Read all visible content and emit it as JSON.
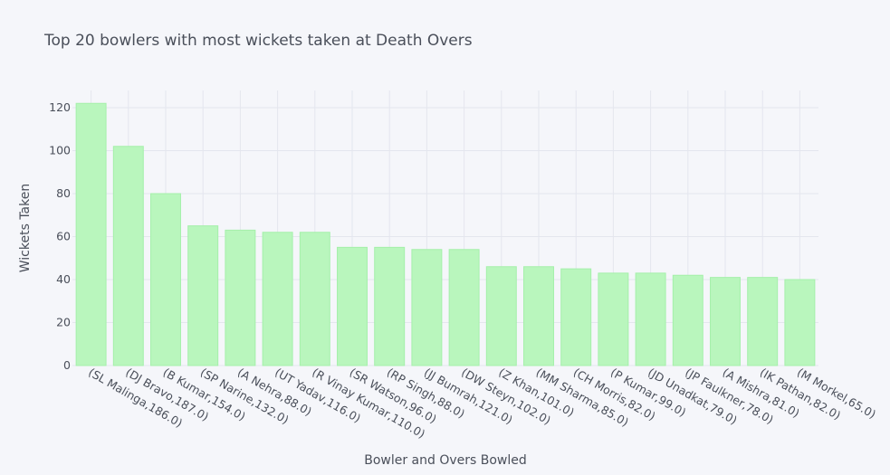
{
  "chart_data": {
    "type": "bar",
    "title": "Top 20 bowlers with most wickets taken at Death Overs",
    "xlabel": "Bowler and Overs Bowled",
    "ylabel": "Wickets Taken",
    "ylim": [
      0,
      128
    ],
    "yticks": [
      0,
      20,
      40,
      60,
      80,
      100,
      120
    ],
    "grid": true,
    "bar_color": "#b9f6bd",
    "background_color": "#f5f6fa",
    "categories": [
      "(SL Malinga,186.0)",
      "(DJ Bravo,187.0)",
      "(B Kumar,154.0)",
      "(SP Narine,132.0)",
      "(A Nehra,88.0)",
      "(UT Yadav,116.0)",
      "(R Vinay Kumar,110.0)",
      "(SR Watson,96.0)",
      "(RP Singh,88.0)",
      "(JJ Bumrah,121.0)",
      "(DW Steyn,102.0)",
      "(Z Khan,101.0)",
      "(MM Sharma,85.0)",
      "(CH Morris,82.0)",
      "(P Kumar,99.0)",
      "(JD Unadkat,79.0)",
      "(JP Faulkner,78.0)",
      "(A Mishra,81.0)",
      "(IK Pathan,82.0)",
      "(M Morkel,65.0)"
    ],
    "values": [
      122,
      102,
      80,
      65,
      63,
      62,
      62,
      55,
      55,
      54,
      54,
      46,
      46,
      45,
      43,
      43,
      42,
      41,
      41,
      40
    ]
  }
}
